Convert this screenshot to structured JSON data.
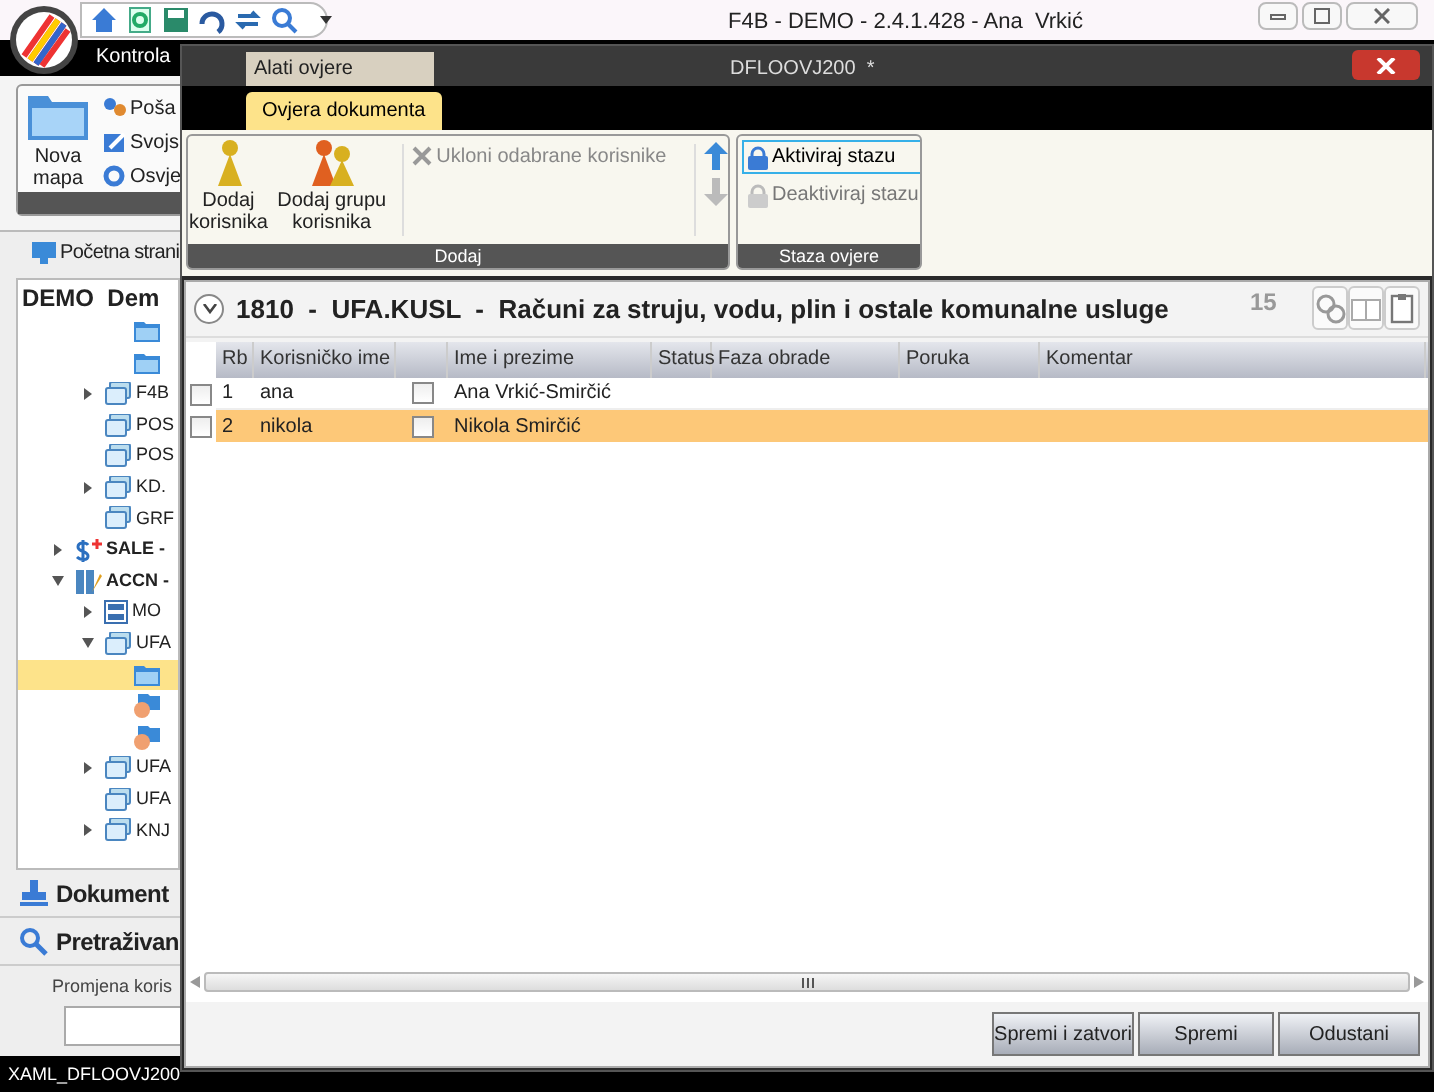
{
  "app": {
    "title": "F4B - DEMO - 2.4.1.428 - Ana  Vrkić",
    "ribbon_tab": "Kontrola",
    "new_folder_button": "Nova mapa",
    "small_buttons": [
      "Poša",
      "Svojs",
      "Osvje"
    ],
    "home_tab": "Početna strani"
  },
  "tree": {
    "header": "DEMO  Dem",
    "continued_children": [
      {
        "kind": "folder",
        "selected": false
      },
      {
        "kind": "folder",
        "selected": false
      }
    ],
    "continued_siblings": [
      {
        "kind": "package",
        "label": "F4B",
        "expanded": false,
        "selected": false
      },
      {
        "kind": "package",
        "label": "POS",
        "selected": false
      },
      {
        "kind": "package",
        "label": "POS",
        "selected": false
      },
      {
        "kind": "package",
        "label": "KD.",
        "expanded": false,
        "selected": false
      },
      {
        "kind": "package",
        "label": "GRF",
        "selected": false
      }
    ],
    "nodes": [
      {
        "kind": "dollar",
        "label": "SALE -",
        "expanded": false,
        "selected": false
      },
      {
        "kind": "chart",
        "label": "ACCN -",
        "expanded": true,
        "selected": false,
        "children": [
          {
            "kind": "form",
            "label": "MO",
            "expanded": false,
            "selected": false
          },
          {
            "kind": "package",
            "label": "UFA",
            "expanded": true,
            "selected": false,
            "children": [
              {
                "kind": "folder",
                "selected": true
              },
              {
                "kind": "hand",
                "selected": false
              },
              {
                "kind": "hand",
                "selected": false
              }
            ]
          },
          {
            "kind": "package",
            "label": "UFA",
            "expanded": false,
            "selected": false
          },
          {
            "kind": "package",
            "label": "UFA",
            "selected": false
          },
          {
            "kind": "package",
            "label": "KNJ",
            "expanded": false,
            "selected": false
          }
        ]
      }
    ]
  },
  "sections": [
    {
      "kind": "documents",
      "label": "Dokument"
    },
    {
      "kind": "search",
      "label": "Pretraživan"
    }
  ],
  "user_change": {
    "label": "Promjena koris"
  },
  "status_bar": "XAML_DFLOOVJ200",
  "dialog": {
    "title": "DFLOOVJ200  *",
    "context_tab": "Alati ovjere",
    "tabs": [
      {
        "label": "Ovjera dokumenta",
        "selected": true
      }
    ],
    "add_group": {
      "label": "Dodaj",
      "add_user": "Dodaj korisnika",
      "add_user_group": "Dodaj grupu korisnika",
      "remove": {
        "label": "Ukloni odabrane korisnike",
        "disabled": true
      },
      "move_up": {
        "disabled": false
      },
      "move_down": {
        "disabled": true
      }
    },
    "path_group": {
      "label": "Staza ovjere",
      "activate": {
        "label": "Aktiviraj stazu",
        "disabled": false,
        "focused": true
      },
      "deactivate": {
        "label": "Deaktiviraj stazu",
        "disabled": true,
        "focused": false
      }
    },
    "document": {
      "title": "1810  -  UFA.KUSL  -  Računi za struju, vodu, plin i ostale komunalne usluge",
      "count": "15"
    },
    "grid": {
      "columns": [
        "Rb",
        "Korisničko ime",
        "Ime i prezime",
        "Status",
        "Faza obrade",
        "Poruka",
        "Komentar"
      ],
      "rows": [
        {
          "checked": false,
          "rb": "1",
          "username": "ana",
          "flag": false,
          "full_name": "Ana Vrkić-Smirčić",
          "selected": false
        },
        {
          "checked": false,
          "rb": "2",
          "username": "nikola",
          "flag": false,
          "full_name": "Nikola Smirčić",
          "selected": true
        }
      ]
    },
    "buttons": [
      "Spremi i zatvori",
      "Spremi",
      "Odustani"
    ]
  }
}
